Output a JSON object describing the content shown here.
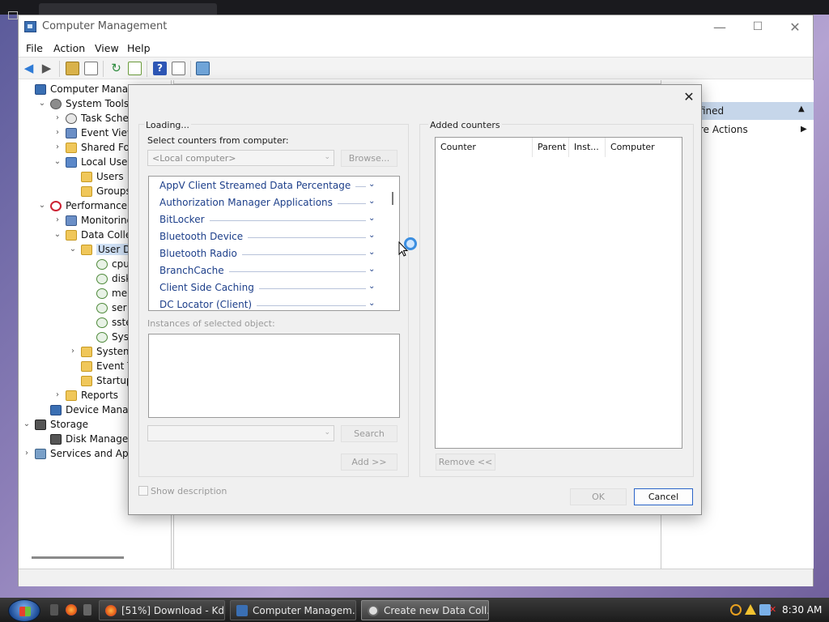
{
  "window": {
    "title": "Computer Management",
    "controls": {
      "minimize": "—",
      "maximize": "☐",
      "close": "✕"
    }
  },
  "menubar": [
    "File",
    "Action",
    "View",
    "Help"
  ],
  "tree": [
    {
      "label": "Computer Managem",
      "indent": 0,
      "chevron": "",
      "icon": "computer-icon"
    },
    {
      "label": "System Tools",
      "indent": 1,
      "chevron": "⌄",
      "icon": "tools-icon"
    },
    {
      "label": "Task Schedule",
      "indent": 2,
      "chevron": "›",
      "icon": "clock-icon"
    },
    {
      "label": "Event Viewer",
      "indent": 2,
      "chevron": "›",
      "icon": "event-viewer-icon"
    },
    {
      "label": "Shared Folders",
      "indent": 2,
      "chevron": "›",
      "icon": "shared-folder-icon"
    },
    {
      "label": "Local Users an",
      "indent": 2,
      "chevron": "⌄",
      "icon": "users-icon"
    },
    {
      "label": "Users",
      "indent": 3,
      "chevron": "",
      "icon": "folder-icon"
    },
    {
      "label": "Groups",
      "indent": 3,
      "chevron": "",
      "icon": "folder-icon"
    },
    {
      "label": "Performance",
      "indent": 1,
      "chevron": "⌄",
      "icon": "performance-icon"
    },
    {
      "label": "Monitoring",
      "indent": 2,
      "chevron": "›",
      "icon": "monitor-icon"
    },
    {
      "label": "Data Colle",
      "indent": 2,
      "chevron": "⌄",
      "icon": "folder-icon"
    },
    {
      "label": "User De",
      "indent": 3,
      "chevron": "⌄",
      "icon": "user-folder-icon",
      "selected": true
    },
    {
      "label": "cpu",
      "indent": 4,
      "chevron": "",
      "icon": "data-collector-icon"
    },
    {
      "label": "disk",
      "indent": 4,
      "chevron": "",
      "icon": "data-collector-icon"
    },
    {
      "label": "me",
      "indent": 4,
      "chevron": "",
      "icon": "data-collector-icon"
    },
    {
      "label": "ser",
      "indent": 4,
      "chevron": "",
      "icon": "data-collector-icon"
    },
    {
      "label": "sste",
      "indent": 4,
      "chevron": "",
      "icon": "data-collector-icon"
    },
    {
      "label": "Sys",
      "indent": 4,
      "chevron": "",
      "icon": "data-collector-icon"
    },
    {
      "label": "System",
      "indent": 3,
      "chevron": "›",
      "icon": "folder-icon"
    },
    {
      "label": "Event T",
      "indent": 3,
      "chevron": "",
      "icon": "folder-icon"
    },
    {
      "label": "Startup",
      "indent": 3,
      "chevron": "",
      "icon": "folder-icon"
    },
    {
      "label": "Reports",
      "indent": 2,
      "chevron": "›",
      "icon": "reports-icon"
    },
    {
      "label": "Device Manag",
      "indent": 1,
      "chevron": "",
      "icon": "device-manager-icon"
    },
    {
      "label": "Storage",
      "indent": 0,
      "chevron": "⌄",
      "icon": "storage-icon"
    },
    {
      "label": "Disk Managem",
      "indent": 1,
      "chevron": "",
      "icon": "disk-icon"
    },
    {
      "label": "Services and Appl",
      "indent": 0,
      "chevron": "›",
      "icon": "services-icon"
    }
  ],
  "actions": {
    "header": "fined",
    "more": "re Actions"
  },
  "dialog": {
    "close": "✕",
    "loading": "Loading...",
    "select_from": "Select counters from computer:",
    "computer_value": "<Local computer>",
    "browse": "Browse...",
    "counters": [
      "AppV Client Streamed Data Percentage",
      "Authorization Manager Applications",
      "BitLocker",
      "Bluetooth Device",
      "Bluetooth Radio",
      "BranchCache",
      "Client Side Caching",
      "DC Locator (Client)"
    ],
    "instances_label": "Instances of selected object:",
    "search": "Search",
    "add": "Add >>",
    "added_counters": "Added counters",
    "columns": [
      "Counter",
      "Parent",
      "Inst...",
      "Computer"
    ],
    "remove": "Remove <<",
    "show_description": "Show description",
    "ok": "OK",
    "cancel": "Cancel"
  },
  "taskbar": {
    "tasks": [
      "[51%] Download - Kd...",
      "Computer Managem...",
      "Create new Data Coll..."
    ],
    "clock": "8:30 AM"
  }
}
